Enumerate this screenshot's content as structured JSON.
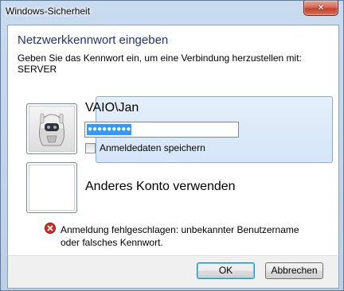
{
  "window": {
    "title": "Windows-Sicherheit",
    "close_glyph": "×"
  },
  "dialog": {
    "heading": "Netzwerkkennwort eingeben",
    "description_line1": "Geben Sie das Kennwort ein, um eine Verbindung herzustellen mit:",
    "description_line2": "SERVER"
  },
  "accounts": {
    "selected": {
      "username": "VAIO\\Jan",
      "password_masked": "●●●●●●●●●",
      "remember_label": "Anmeldedaten speichern",
      "remember_checked": false,
      "avatar_icon": "user-avatar-robot-icon"
    },
    "other": {
      "label": "Anderes Konto verwenden"
    }
  },
  "error": {
    "icon": "error-icon",
    "line1": "Anmeldung fehlgeschlagen: unbekannter Benutzername",
    "line2": "oder falsches Kennwort."
  },
  "buttons": {
    "ok": "OK",
    "cancel": "Abbrechen"
  },
  "colors": {
    "heading": "#1e3287",
    "selection": "#3399ff",
    "error_red": "#d52b1e"
  }
}
